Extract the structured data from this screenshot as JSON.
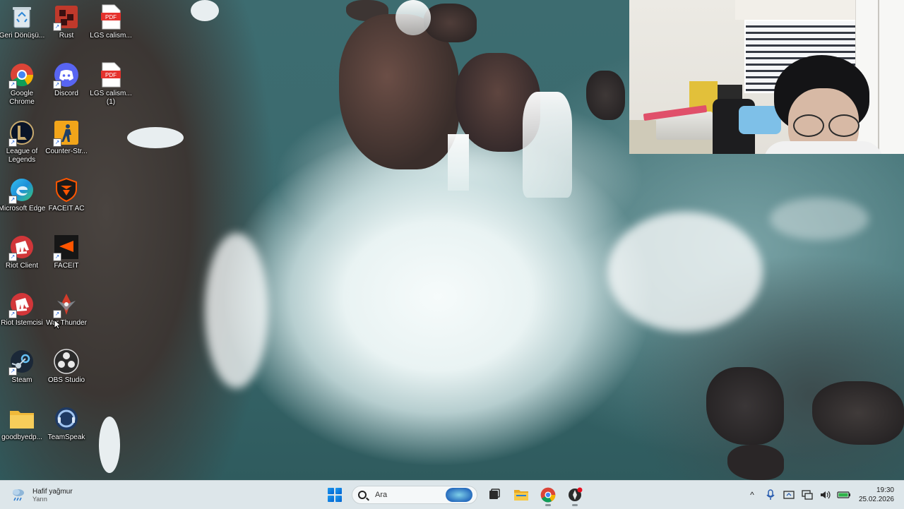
{
  "desktop": {
    "icons": [
      {
        "label": "Geri Dönüşü...",
        "icon": "recycle-bin-icon"
      },
      {
        "label": "Rust",
        "icon": "rust-game-icon"
      },
      {
        "label": "LGS calism...",
        "icon": "pdf-file-icon"
      },
      {
        "label": "Google Chrome",
        "icon": "chrome-icon"
      },
      {
        "label": "Discord",
        "icon": "discord-icon"
      },
      {
        "label": "LGS calism... (1)",
        "icon": "pdf-file-icon"
      },
      {
        "label": "League of Legends",
        "icon": "league-of-legends-icon"
      },
      {
        "label": "Counter-Str...",
        "icon": "counter-strike-icon"
      },
      {
        "label": "Microsoft Edge",
        "icon": "edge-icon"
      },
      {
        "label": "FACEIT AC",
        "icon": "faceit-ac-icon"
      },
      {
        "label": "Riot Client",
        "icon": "riot-client-icon"
      },
      {
        "label": "FACEIT",
        "icon": "faceit-icon"
      },
      {
        "label": "Riot İstemcisi",
        "icon": "riot-client-icon"
      },
      {
        "label": "War Thunder",
        "icon": "war-thunder-icon"
      },
      {
        "label": "Steam",
        "icon": "steam-icon"
      },
      {
        "label": "OBS Studio",
        "icon": "obs-studio-icon"
      },
      {
        "label": "goodbyedp...",
        "icon": "folder-icon"
      },
      {
        "label": "TeamSpeak",
        "icon": "teamspeak-icon"
      }
    ],
    "pdf_badge": "PDF"
  },
  "taskbar": {
    "weather": {
      "condition": "Hafif yağmur",
      "sub": "Yarın"
    },
    "search": {
      "placeholder": "Ara"
    },
    "pinned": [
      {
        "name": "task-view-icon"
      },
      {
        "name": "file-explorer-icon"
      },
      {
        "name": "chrome-icon"
      },
      {
        "name": "war-thunder-icon"
      }
    ],
    "tray": {
      "chevron": "^",
      "time": "19:30",
      "date": "25.02.2026"
    }
  },
  "colors": {
    "taskbar_bg": "#dde6ea",
    "accent": "#0078d4"
  }
}
